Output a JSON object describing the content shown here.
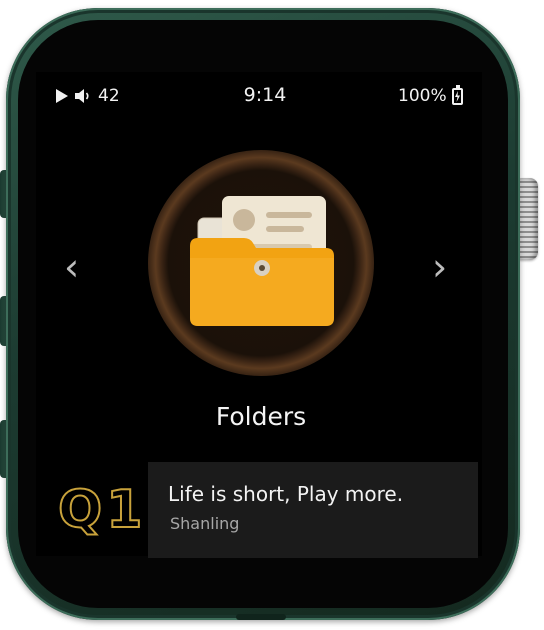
{
  "status": {
    "volume": "42",
    "time": "9:14",
    "battery": "100%"
  },
  "menu": {
    "current_label": "Folders",
    "icon": "folder-icon"
  },
  "info": {
    "logo": "Q1",
    "tagline": "Life is short, Play more.",
    "brand": "Shanling"
  },
  "colors": {
    "body": "#1f3d33",
    "folder": "#f0a10e",
    "logo_gold": "#c8a23b",
    "card_bg": "#1b1b1b"
  }
}
